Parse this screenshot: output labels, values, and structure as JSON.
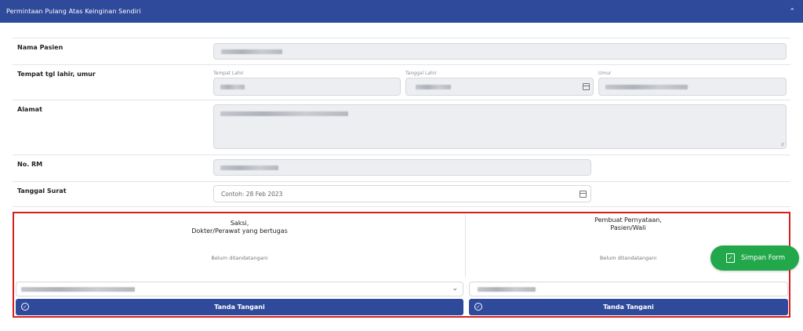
{
  "header": {
    "title": "Permintaan Pulang Atas Keinginan Sendiri",
    "collapse_icon": "chevron-up-icon"
  },
  "form": {
    "nama_pasien": {
      "label": "Nama Pasien"
    },
    "tempat_tgl_lahir": {
      "label": "Tempat tgl lahir, umur",
      "tempat_lahir_label": "Tempat Lahir",
      "tanggal_lahir_label": "Tanggal Lahir",
      "umur_label": "Umur"
    },
    "alamat": {
      "label": "Alamat"
    },
    "no_rm": {
      "label": "No. RM"
    },
    "tanggal_surat": {
      "label": "Tanggal Surat",
      "placeholder": "Contoh: 28 Feb 2023"
    }
  },
  "signatures": {
    "witness": {
      "title_line1": "Saksi,",
      "title_line2": "Dokter/Perawat yang bertugas",
      "status": "Belum ditandatangani",
      "button_label": "Tanda Tangani"
    },
    "declarant": {
      "title_line1": "Pembuat Pernyataan,",
      "title_line2": "Pasien/Wali",
      "status": "Belum ditandatangani",
      "button_label": "Tanda Tangani"
    }
  },
  "save_button": {
    "label": "Simpan Form"
  },
  "colors": {
    "header": "#2f4a9a",
    "button": "#2f4a9a",
    "save": "#22a84a",
    "highlight_border": "#d62020"
  }
}
